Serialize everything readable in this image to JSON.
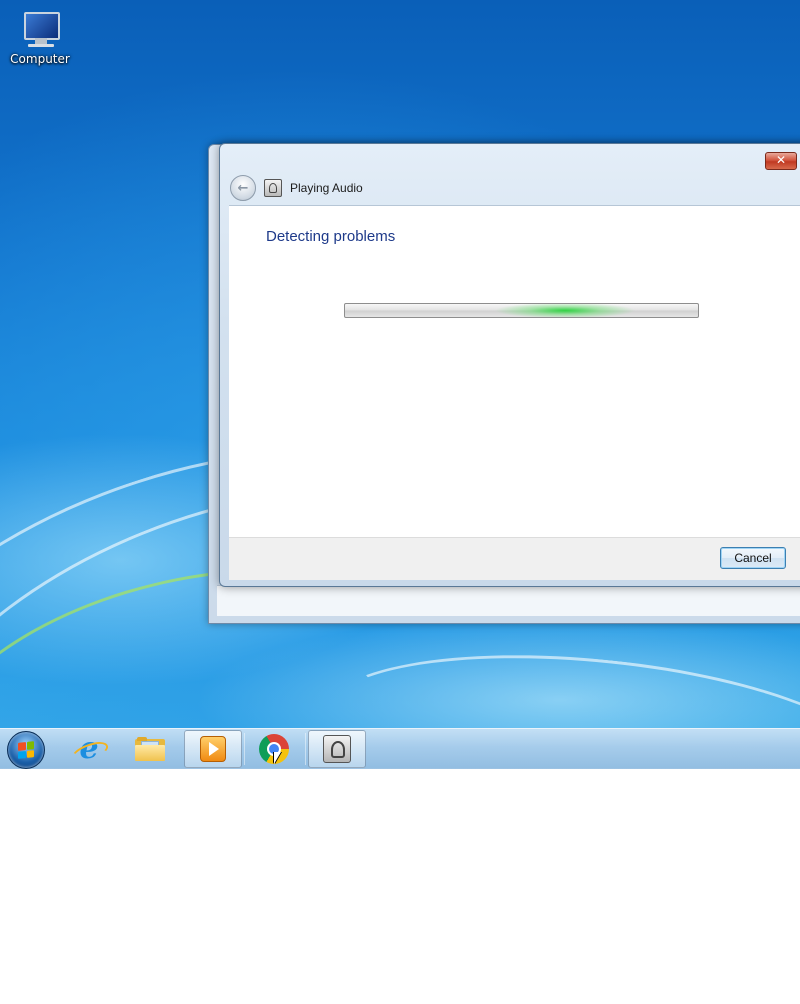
{
  "desktop": {
    "icons": [
      {
        "label": "Computer",
        "icon": "computer-icon"
      }
    ]
  },
  "dialog": {
    "title": "Playing Audio",
    "close_label": "✕",
    "back_label": "←",
    "heading": "Detecting problems",
    "progress": {
      "state": "indeterminate",
      "color": "#2bd13f"
    },
    "cancel_label": "Cancel"
  },
  "taskbar": {
    "items": [
      {
        "name": "start-button",
        "icon": "windows-flag-icon"
      },
      {
        "name": "internet-explorer",
        "icon": "internet-explorer-icon",
        "glyph": "e"
      },
      {
        "name": "windows-explorer",
        "icon": "folder-icon"
      },
      {
        "name": "media-player",
        "icon": "media-player-icon",
        "active": true
      },
      {
        "name": "chrome",
        "icon": "chrome-icon"
      },
      {
        "name": "playing-audio-troubleshooter",
        "icon": "speaker-icon",
        "active": true
      }
    ]
  }
}
